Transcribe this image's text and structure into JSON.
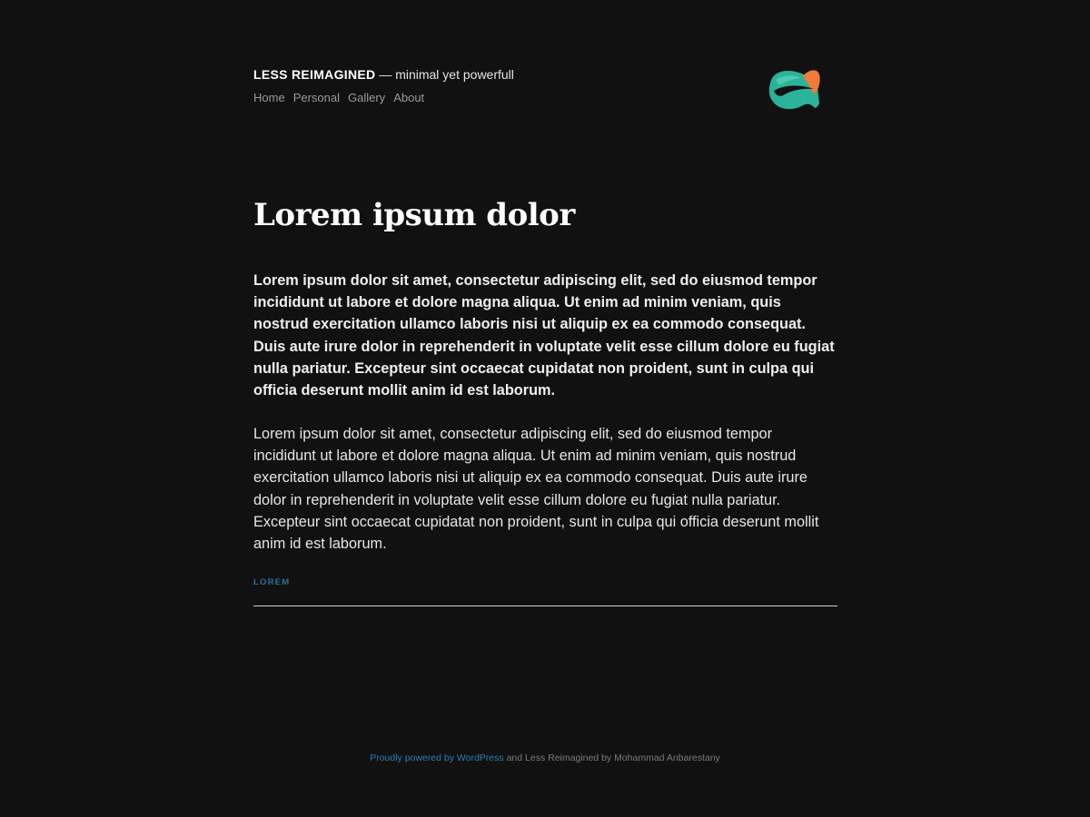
{
  "header": {
    "site_title": "LESS REIMAGINED",
    "separator": " — ",
    "tagline": "minimal yet powerfull",
    "nav": [
      {
        "label": "Home"
      },
      {
        "label": "Personal"
      },
      {
        "label": "Gallery"
      },
      {
        "label": "About"
      }
    ],
    "logo": {
      "icon": "fish-logo-icon",
      "colors": {
        "teal": "#2bb39a",
        "orange": "#f07a3a",
        "dark": "#111112"
      }
    }
  },
  "post": {
    "title": "Lorem ipsum dolor",
    "lead": "Lorem ipsum dolor sit amet, consectetur adipiscing elit, sed do eiusmod tempor incididunt ut labore et dolore magna aliqua. Ut enim ad minim veniam, quis nostrud exercitation ullamco laboris nisi ut aliquip ex ea commodo consequat. Duis aute irure dolor in reprehenderit in voluptate velit esse cillum dolore eu fugiat nulla pariatur. Excepteur sint occaecat cupidatat non proident, sunt in culpa qui officia deserunt mollit anim id est laborum.",
    "body": "Lorem ipsum dolor sit amet, consectetur adipiscing elit, sed do eiusmod tempor incididunt ut labore et dolore magna aliqua. Ut enim ad minim veniam, quis nostrud exercitation ullamco laboris nisi ut aliquip ex ea commodo consequat. Duis aute irure dolor in reprehenderit in voluptate velit esse cillum dolore eu fugiat nulla pariatur. Excepteur sint occaecat cupidatat non proident, sunt in culpa qui officia deserunt mollit anim id est laborum.",
    "tag": "LOREM"
  },
  "footer": {
    "powered_link": "Proudly powered by WordPress",
    "credit": " and Less Reimagined by Mohammad Anbarestany"
  },
  "colors": {
    "background": "#111112",
    "link": "#2a7fae",
    "nav": "#9a9a9a"
  }
}
